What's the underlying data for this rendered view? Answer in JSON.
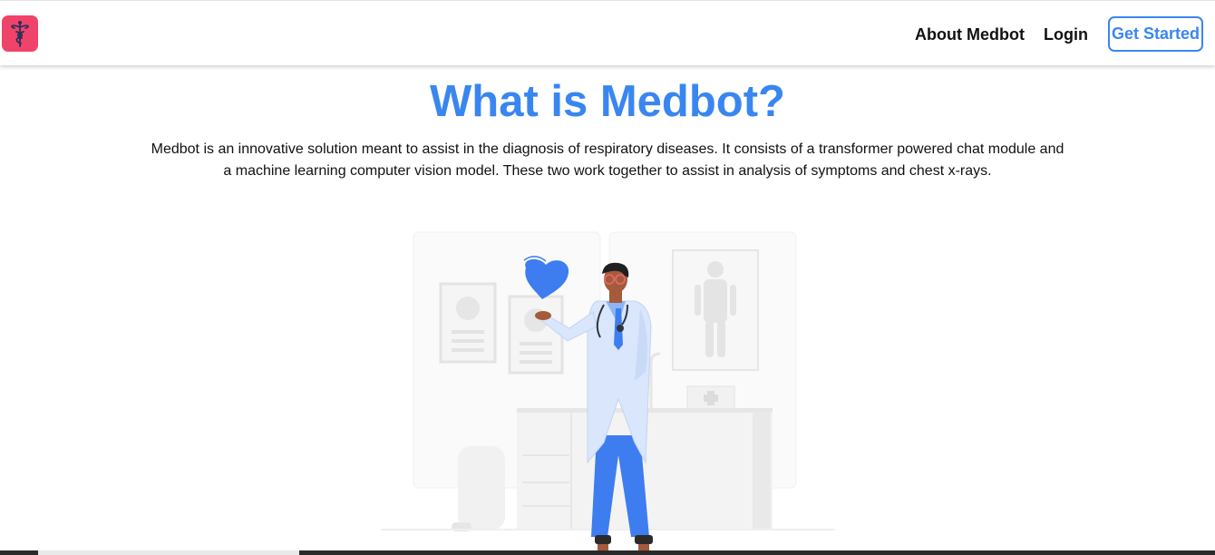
{
  "navbar": {
    "logo_icon": "caduceus-icon",
    "logo_color": "#f0436a",
    "links": [
      {
        "label": "About Medbot"
      },
      {
        "label": "Login"
      }
    ],
    "cta_label": "Get Started",
    "accent_color": "#3a86f0"
  },
  "hero": {
    "title": "What is Medbot?",
    "description": "Medbot is an innovative solution meant to assist in the diagnosis of respiratory diseases. It consists of a transformer powered chat module and a machine learning computer vision model. These two work together to assist in analysis of symptoms and chest x-rays."
  },
  "illustration": {
    "icon": "doctor-holding-heart-illustration"
  }
}
